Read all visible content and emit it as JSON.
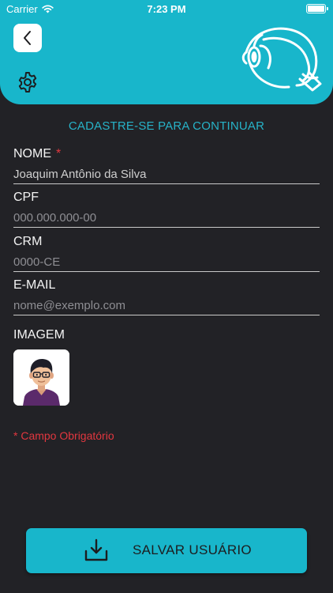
{
  "status_bar": {
    "carrier": "Carrier",
    "time": "7:23 PM"
  },
  "header": {
    "back_icon": "chevron-left-icon",
    "settings_icon": "gear-icon",
    "logo_icon": "eye-anatomy-icon"
  },
  "form": {
    "title": "CADASTRE-SE PARA CONTINUAR",
    "fields": [
      {
        "label": "NOME",
        "required_mark": "*",
        "value": "Joaquim Antônio da Silva",
        "placeholder": ""
      },
      {
        "label": "CPF",
        "required_mark": "",
        "value": "",
        "placeholder": "000.000.000-00"
      },
      {
        "label": "CRM",
        "required_mark": "",
        "value": "",
        "placeholder": "0000-CE"
      },
      {
        "label": "E-MAIL",
        "required_mark": "",
        "value": "",
        "placeholder": "nome@exemplo.com"
      }
    ],
    "image_label": "IMAGEM",
    "required_note": "* Campo Obrigatório"
  },
  "save_button": {
    "label": "SALVAR USUÁRIO",
    "icon": "download-icon"
  },
  "colors": {
    "accent": "#18b6cb",
    "background": "#222226",
    "required": "#e2373f"
  }
}
